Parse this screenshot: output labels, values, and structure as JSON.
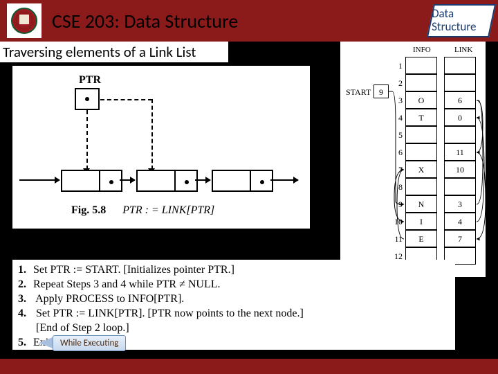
{
  "header": {
    "title": "CSE 203: Data Structure",
    "badge": "Data Structure"
  },
  "subtitle": "Traversing elements of a Link List",
  "diagram": {
    "ptr_label": "PTR",
    "fig_label": "Fig. 5.8",
    "fig_formula": "PTR : = LINK[PTR]"
  },
  "table": {
    "header_info": "INFO",
    "header_link": "LINK",
    "start_label": "START",
    "start_value": "9",
    "rows": [
      {
        "n": "1",
        "info": "",
        "link": ""
      },
      {
        "n": "2",
        "info": "",
        "link": ""
      },
      {
        "n": "3",
        "info": "O",
        "link": "6"
      },
      {
        "n": "4",
        "info": "T",
        "link": "0"
      },
      {
        "n": "5",
        "info": "",
        "link": ""
      },
      {
        "n": "6",
        "info": "",
        "link": "11"
      },
      {
        "n": "7",
        "info": "X",
        "link": "10"
      },
      {
        "n": "8",
        "info": "",
        "link": ""
      },
      {
        "n": "9",
        "info": "N",
        "link": "3"
      },
      {
        "n": "10",
        "info": "I",
        "link": "4"
      },
      {
        "n": "11",
        "info": "E",
        "link": "7"
      },
      {
        "n": "12",
        "info": "",
        "link": ""
      }
    ]
  },
  "algorithm": {
    "lines": [
      {
        "n": "1.",
        "text": "Set PTR := START. [Initializes pointer PTR.]"
      },
      {
        "n": "2.",
        "text": "Repeat Steps 3 and 4 while PTR ≠ NULL."
      },
      {
        "n": "3.",
        "text": "    Apply PROCESS to INFO[PTR]."
      },
      {
        "n": "4.",
        "text": "    Set PTR := LINK[PTR]. [PTR now points to the next node.]"
      },
      {
        "n": "",
        "text": "    [End of Step 2 loop.]"
      },
      {
        "n": "5.",
        "text": "Exit."
      }
    ]
  },
  "exec_tag": "While Executing"
}
